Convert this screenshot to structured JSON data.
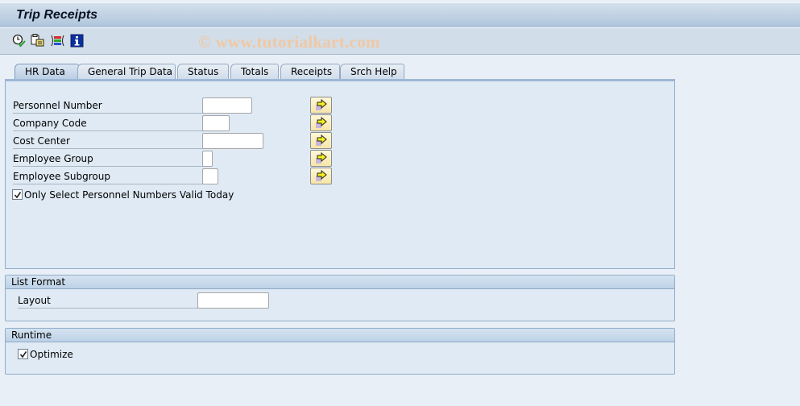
{
  "window": {
    "title": "Trip Receipts",
    "watermark": "© www.tutorialkart.com"
  },
  "toolbar": {
    "buttons": [
      {
        "name": "execute",
        "icon": "clock-check-icon"
      },
      {
        "name": "get-variant",
        "icon": "copy-variant-icon"
      },
      {
        "name": "selection-options",
        "icon": "selection-options-icon"
      },
      {
        "name": "information",
        "icon": "info-icon"
      }
    ]
  },
  "tabs": [
    {
      "label": "HR Data",
      "active": true
    },
    {
      "label": "General Trip Data",
      "active": false
    },
    {
      "label": "Status",
      "active": false
    },
    {
      "label": "Totals",
      "active": false
    },
    {
      "label": "Receipts",
      "active": false
    },
    {
      "label": "Srch Help",
      "active": false
    }
  ],
  "hr_data": {
    "fields": [
      {
        "label": "Personnel Number",
        "value": ""
      },
      {
        "label": "Company Code",
        "value": ""
      },
      {
        "label": "Cost Center",
        "value": ""
      },
      {
        "label": "Employee Group",
        "value": ""
      },
      {
        "label": "Employee Subgroup",
        "value": ""
      }
    ],
    "multiple_selection_icon": "arrow-right-icon",
    "valid_today_checkbox": {
      "label": "Only Select Personnel Numbers Valid Today",
      "checked": true
    }
  },
  "list_format": {
    "title": "List Format",
    "layout_label": "Layout",
    "layout_value": ""
  },
  "runtime": {
    "title": "Runtime",
    "optimize_label": "Optimize",
    "optimize_checked": true
  }
}
